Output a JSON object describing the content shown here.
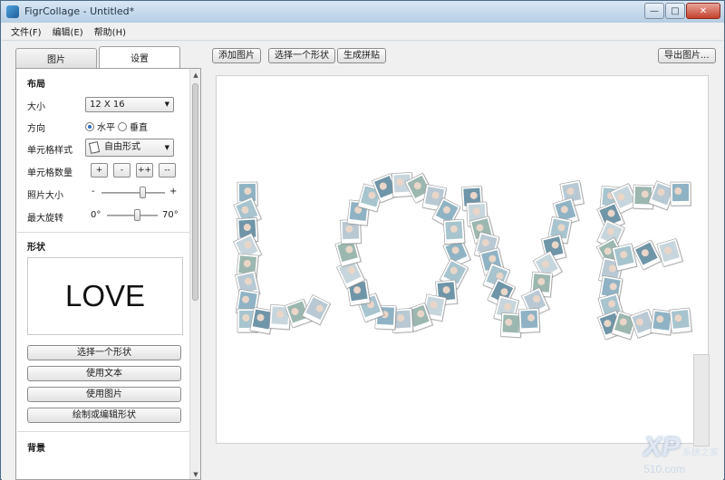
{
  "window": {
    "title": "FigrCollage - Untitled*",
    "min_glyph": "—",
    "max_glyph": "□",
    "close_glyph": "✕"
  },
  "menu": [
    "文件(F)",
    "编辑(E)",
    "帮助(H)"
  ],
  "tabs": [
    "图片",
    "设置"
  ],
  "active_tab": "设置",
  "toolbar": {
    "add_photos": "添加图片",
    "choose_shape": "选择一个形状",
    "generate": "生成拼贴",
    "export": "导出图片..."
  },
  "layout": {
    "heading": "布局",
    "size_label": "大小",
    "size_value": "12 X 16",
    "direction_label": "方向",
    "horizontal": "水平",
    "vertical": "垂直",
    "direction_selected": "水平",
    "cell_style_label": "单元格样式",
    "cell_style_value": "自由形式",
    "cell_count_label": "单元格数量",
    "cell_count_buttons": [
      "+",
      "-",
      "++",
      "--"
    ],
    "photo_size_label": "照片大小",
    "photo_size_minus": "-",
    "photo_size_plus": "+",
    "photo_size_level": 0.65,
    "max_rotation_label": "最大旋转",
    "rotation_min": "0°",
    "rotation_max": "70°",
    "rotation_level": 0.6
  },
  "shape": {
    "heading": "形状",
    "preview_text": "LOVE",
    "choose_shape": "选择一个形状",
    "use_text": "使用文本",
    "use_image": "使用图片",
    "draw_edit": "绘制或编辑形状"
  },
  "background": {
    "heading": "背景"
  },
  "canvas": {
    "collage_word": "LOVE"
  },
  "watermark": {
    "brand": "XP",
    "site": "510.com",
    "cn": "系统之家"
  },
  "colors": {
    "titlebar": "#c8dbee",
    "accent": "#2a6dbf",
    "canvas_bg": "#ffffff"
  }
}
